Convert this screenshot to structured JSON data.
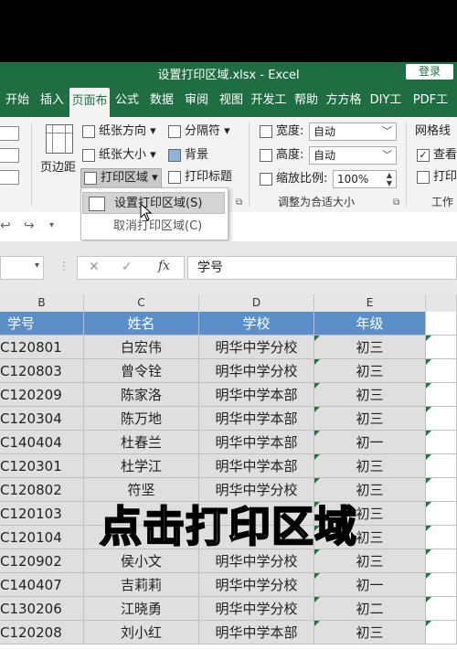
{
  "window": {
    "title": "设置打印区域.xlsx  -  Excel",
    "login": "登录"
  },
  "tabs": [
    {
      "label": "开始"
    },
    {
      "label": "插入"
    },
    {
      "label": "页面布"
    },
    {
      "label": "公式"
    },
    {
      "label": "数据"
    },
    {
      "label": "审阅"
    },
    {
      "label": "视图"
    },
    {
      "label": "开发工"
    },
    {
      "label": "帮助"
    },
    {
      "label": "方方格"
    },
    {
      "label": "DIY工"
    },
    {
      "label": "PDF工"
    }
  ],
  "ribbon": {
    "margins": "页边距",
    "orientation": "纸张方向",
    "size": "纸张大小",
    "print_area": "打印区域",
    "breaks": "分隔符",
    "background": "背景",
    "print_titles": "打印标题",
    "width_label": "宽度:",
    "width_value": "自动",
    "height_label": "高度:",
    "height_value": "自动",
    "scale_label": "缩放比例:",
    "scale_value": "100%",
    "group_scale": "调整为合适大小",
    "gridlines": "网格线",
    "view": "查看",
    "print": "打印",
    "group_sheet": "工作"
  },
  "dropdown": {
    "set_print_area": "设置打印区域(S)",
    "clear_print_area": "取消打印区域(C)"
  },
  "formula": {
    "content": "学号",
    "fx": "fx"
  },
  "columns": [
    "B",
    "C",
    "D",
    "E"
  ],
  "table": {
    "headers": [
      "学号",
      "姓名",
      "学校",
      "年级"
    ],
    "rows": [
      [
        "C120801",
        "白宏伟",
        "明华中学分校",
        "初三"
      ],
      [
        "C120803",
        "曾令铨",
        "明华中学分校",
        "初三"
      ],
      [
        "C120209",
        "陈家洛",
        "明华中学本部",
        "初三"
      ],
      [
        "C120304",
        "陈万地",
        "明华中学本部",
        "初三"
      ],
      [
        "C140404",
        "杜春兰",
        "明华中学本部",
        "初一"
      ],
      [
        "C120301",
        "杜学江",
        "明华中学本部",
        "初三"
      ],
      [
        "C120802",
        "符坚",
        "明华中学分校",
        "初三"
      ],
      [
        "C120103",
        "",
        "",
        "初三"
      ],
      [
        "C120104",
        "",
        "",
        "初三"
      ],
      [
        "C120902",
        "侯小文",
        "明华中学分校",
        "初三"
      ],
      [
        "C140407",
        "吉莉莉",
        "明华中学分校",
        "初一"
      ],
      [
        "C130206",
        "江晓勇",
        "明华中学分校",
        "初二"
      ],
      [
        "C120208",
        "刘小红",
        "明华中学本部",
        "初三"
      ]
    ]
  },
  "caption": "点击打印区域",
  "colors": {
    "excel_green": "#1f6e43",
    "header_blue": "#5b8fc8"
  }
}
